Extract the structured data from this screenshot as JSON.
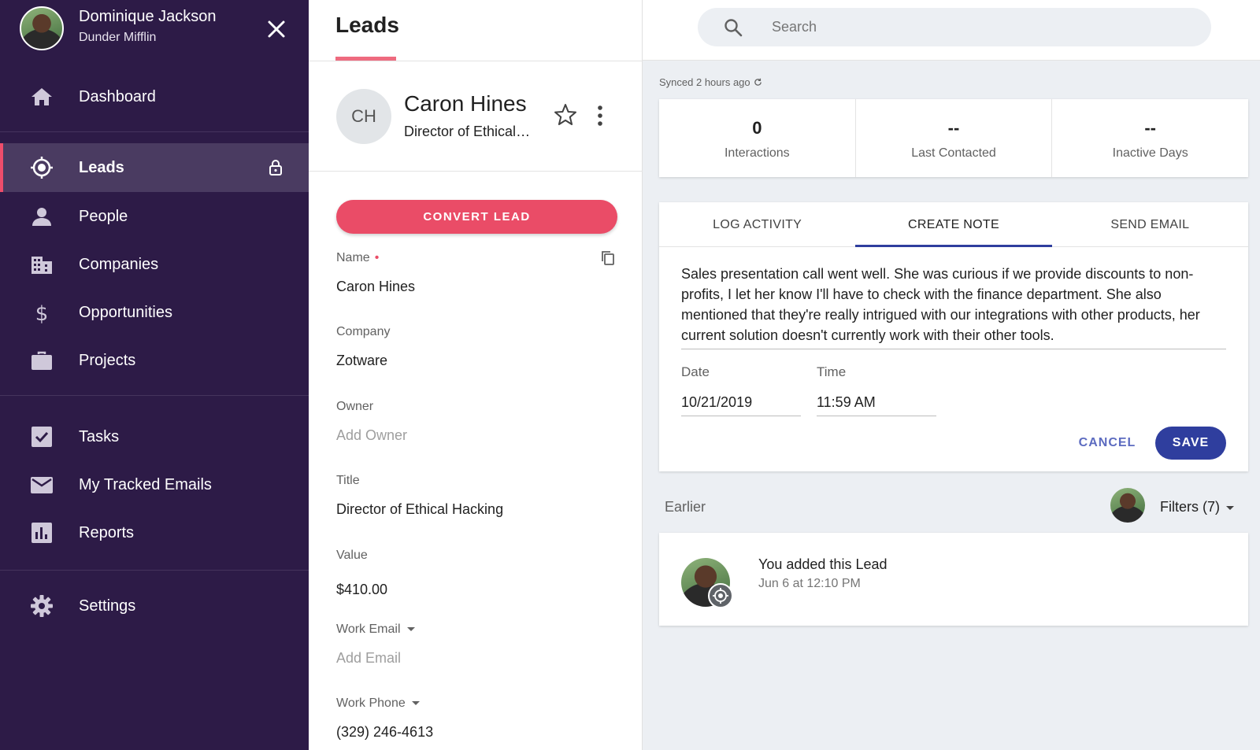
{
  "user": {
    "name": "Dominique Jackson",
    "org": "Dunder Mifflin"
  },
  "nav": {
    "dashboard": "Dashboard",
    "leads": "Leads",
    "people": "People",
    "companies": "Companies",
    "opportunities": "Opportunities",
    "projects": "Projects",
    "tasks": "Tasks",
    "tracked_emails": "My Tracked Emails",
    "reports": "Reports",
    "settings": "Settings"
  },
  "page": {
    "title": "Leads"
  },
  "search": {
    "placeholder": "Search"
  },
  "lead": {
    "initials": "CH",
    "name": "Caron Hines",
    "title_short": "Director of Ethical Hacking",
    "convert_label": "CONVERT LEAD",
    "fields": {
      "name_label": "Name",
      "name_required": "•",
      "name_value": "Caron Hines",
      "company_label": "Company",
      "company_value": "Zotware",
      "owner_label": "Owner",
      "owner_placeholder": "Add Owner",
      "title_label": "Title",
      "title_value": "Director of Ethical Hacking",
      "value_label": "Value",
      "value_value": "$410.00",
      "work_email_label": "Work Email",
      "work_email_placeholder": "Add Email",
      "work_phone_label": "Work Phone",
      "work_phone_value": "(329) 246-4613"
    }
  },
  "sync": {
    "text": "Synced 2 hours ago"
  },
  "stats": [
    {
      "value": "0",
      "label": "Interactions"
    },
    {
      "value": "--",
      "label": "Last Contacted"
    },
    {
      "value": "--",
      "label": "Inactive Days"
    }
  ],
  "note": {
    "tabs": [
      "LOG ACTIVITY",
      "CREATE NOTE",
      "SEND EMAIL"
    ],
    "active_tab": "CREATE NOTE",
    "text": "Sales presentation call went well. She was curious if we provide discounts to non-profits, I let her know I'll have to check with the finance department. She also mentioned that they're really intrigued with our integrations with other products, her current solution doesn't currently work with their other tools.",
    "date_label": "Date",
    "date_value": "10/21/2019",
    "time_label": "Time",
    "time_value": "11:59 AM",
    "cancel_label": "CANCEL",
    "save_label": "SAVE"
  },
  "timeline": {
    "section_label": "Earlier",
    "filters_label": "Filters (7)",
    "items": [
      {
        "title": "You added this Lead",
        "time": "Jun 6 at 12:10 PM"
      }
    ]
  },
  "colors": {
    "sidebar": "#2d1b47",
    "accent_pink": "#ea4c67",
    "accent_blue": "#2f3e9e"
  }
}
